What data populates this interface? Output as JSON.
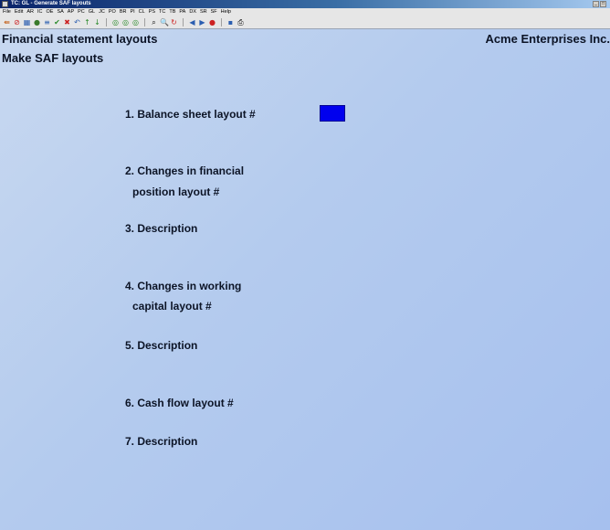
{
  "window": {
    "title": "TC: GL - Generate SAF layouts",
    "minimize_glyph": "_",
    "maximize_glyph": "□"
  },
  "menu": [
    "File",
    "Edit",
    "AR",
    "IC",
    "OE",
    "SA",
    "AP",
    "PC",
    "GL",
    "JC",
    "PO",
    "BR",
    "PI",
    "CL",
    "PS",
    "TC",
    "TB",
    "PA",
    "DX",
    "SR",
    "SF",
    "Help"
  ],
  "toolbar": {
    "icons": [
      {
        "name": "exit-icon",
        "glyph": "⇚",
        "color": "#c05000"
      },
      {
        "name": "stop-icon",
        "glyph": "⊘",
        "color": "#cc2222"
      },
      {
        "name": "calculator-icon",
        "glyph": "▦",
        "color": "#2a5db0"
      },
      {
        "name": "color-icon",
        "glyph": "●",
        "color": "#3a7a2a"
      },
      {
        "name": "list-icon",
        "glyph": "≡",
        "color": "#2a5db0"
      },
      {
        "name": "accept-icon",
        "glyph": "✔",
        "color": "#2a8a2a"
      },
      {
        "name": "cancel-icon",
        "glyph": "✖",
        "color": "#cc2222"
      },
      {
        "name": "undo-icon",
        "glyph": "↶",
        "color": "#2a5db0"
      },
      {
        "name": "up-icon",
        "glyph": "↑",
        "color": "#2a8a2a"
      },
      {
        "name": "down-icon",
        "glyph": "↓",
        "color": "#2a8a2a"
      },
      {
        "name": "sep"
      },
      {
        "name": "refresh-icon",
        "glyph": "◎",
        "color": "#2a8a2a"
      },
      {
        "name": "clear-icon",
        "glyph": "◎",
        "color": "#2a8a2a"
      },
      {
        "name": "settings-icon",
        "glyph": "◎",
        "color": "#2a8a2a"
      },
      {
        "name": "sep"
      },
      {
        "name": "find-icon",
        "glyph": "⌕",
        "color": "#000000"
      },
      {
        "name": "zoom-icon",
        "glyph": "🔍",
        "color": "#000000"
      },
      {
        "name": "reload-icon",
        "glyph": "↻",
        "color": "#cc2222"
      },
      {
        "name": "sep"
      },
      {
        "name": "previous-icon",
        "glyph": "◀",
        "color": "#2a5db0"
      },
      {
        "name": "next-icon",
        "glyph": "▶",
        "color": "#2a5db0"
      },
      {
        "name": "record-icon",
        "glyph": "●",
        "color": "#cc2222"
      },
      {
        "name": "sep"
      },
      {
        "name": "save-icon",
        "glyph": "▪",
        "color": "#2a5db0"
      },
      {
        "name": "print-icon",
        "glyph": "⎙",
        "color": "#000000"
      }
    ]
  },
  "header": {
    "screen_title": "Financial statement layouts",
    "company": "Acme Enterprises Inc.",
    "subtitle": "Make SAF layouts"
  },
  "fields": {
    "f1": "1. Balance sheet layout #",
    "f2a": "2. Changes in financial",
    "f2b": "position layout #",
    "f3": "3. Description",
    "f4a": "4. Changes in working",
    "f4b": "capital layout #",
    "f5": "5. Description",
    "f6": "6. Cash flow layout #",
    "f7": "7. Description"
  },
  "colors": {
    "input_highlight": "#0000ee"
  }
}
